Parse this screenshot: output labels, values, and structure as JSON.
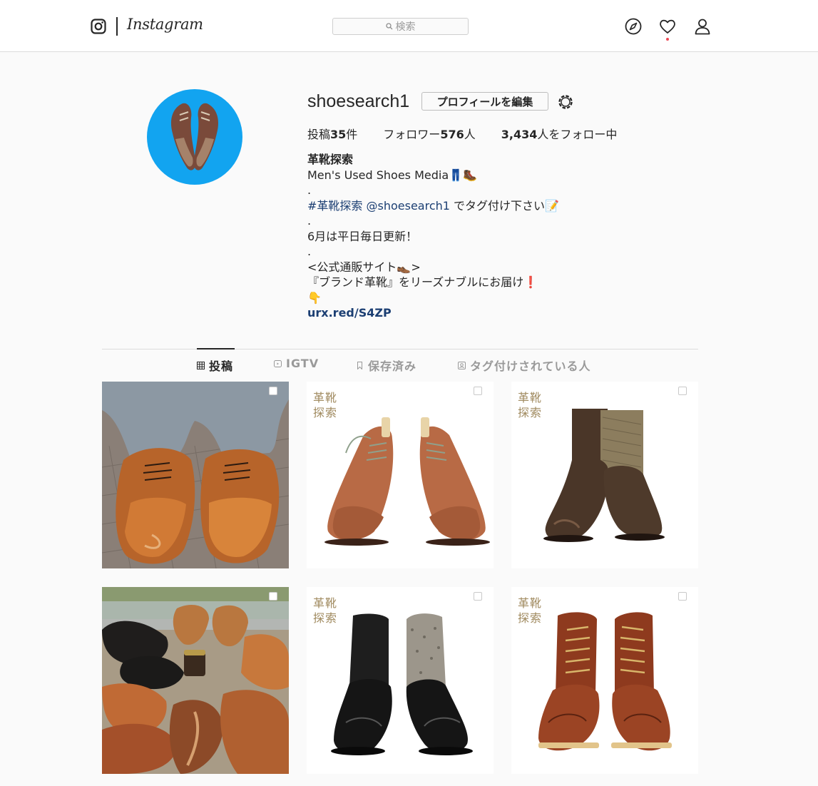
{
  "nav": {
    "brand_name": "Instagram",
    "search_placeholder": "検索",
    "icons": [
      "instagram-logo-icon",
      "search-icon",
      "compass-icon",
      "heart-icon",
      "profile-icon"
    ],
    "notification_dot_color": "#ed4956"
  },
  "profile": {
    "username": "shoesearch1",
    "edit_button_label": "プロフィールを編集",
    "stats": {
      "posts_prefix": "投稿",
      "posts_count": "35",
      "posts_suffix": "件",
      "followers_prefix": "フォロワー",
      "followers_count": "576",
      "followers_suffix": "人",
      "following_count": "3,434",
      "following_suffix": "人をフォロー中"
    },
    "bio": {
      "name": "革靴探索",
      "line1": "Men's Used Shoes Media👖🥾",
      "dot1": ".",
      "hashtag": "#革靴探索",
      "mention": "@shoesearch1",
      "tag_request": " でタグ付け下さい📝",
      "dot2": ".",
      "schedule": "6月は平日毎日更新！",
      "dot3": ".",
      "shop_title": "<公式通販サイト👞>",
      "shop_desc": "『ブランド革靴』をリーズナブルにお届け❗",
      "pointer": "👇",
      "url": "urx.red/S4ZP"
    }
  },
  "tabs": [
    {
      "label": "投稿",
      "icon": "grid-icon",
      "active": true
    },
    {
      "label": "IGTV",
      "icon": "igtv-icon",
      "active": false
    },
    {
      "label": "保存済み",
      "icon": "bookmark-icon",
      "active": false
    },
    {
      "label": "タグ付けされている人",
      "icon": "tagged-icon",
      "active": false
    }
  ],
  "posts": [
    {
      "watermark_line1": "",
      "watermark_line2": ""
    },
    {
      "watermark_line1": "革靴",
      "watermark_line2": "探索"
    },
    {
      "watermark_line1": "革靴",
      "watermark_line2": "探索"
    },
    {
      "watermark_line1": "",
      "watermark_line2": ""
    },
    {
      "watermark_line1": "革靴",
      "watermark_line2": "探索"
    },
    {
      "watermark_line1": "革靴",
      "watermark_line2": "探索"
    }
  ],
  "colors": {
    "link": "#1c3f73",
    "avatar_bg": "#12a4f0",
    "inactive_tab": "#999999"
  }
}
